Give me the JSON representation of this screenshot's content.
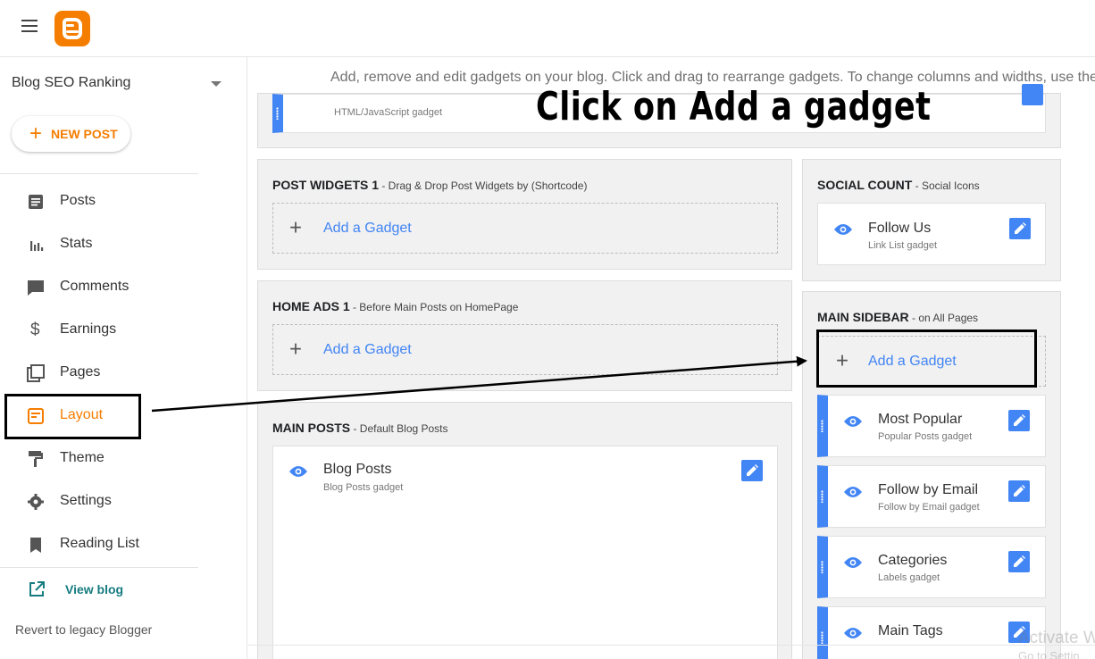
{
  "header": {
    "menu_icon": "hamburger-menu-icon",
    "logo_icon": "blogger-logo-icon",
    "brand_color": "#f57d00"
  },
  "sidebar": {
    "blog_name": "Blog SEO Ranking",
    "new_post_label": "NEW POST",
    "items": [
      {
        "label": "Posts",
        "icon": "posts-icon"
      },
      {
        "label": "Stats",
        "icon": "stats-icon"
      },
      {
        "label": "Comments",
        "icon": "comments-icon"
      },
      {
        "label": "Earnings",
        "icon": "earnings-icon"
      },
      {
        "label": "Pages",
        "icon": "pages-icon"
      },
      {
        "label": "Layout",
        "icon": "layout-icon",
        "active": true
      },
      {
        "label": "Theme",
        "icon": "theme-icon"
      },
      {
        "label": "Settings",
        "icon": "settings-icon"
      },
      {
        "label": "Reading List",
        "icon": "bookmark-icon"
      }
    ],
    "view_blog_label": "View blog",
    "revert_label": "Revert to legacy Blogger"
  },
  "main": {
    "instructions": "Add, remove and edit gadgets on your blog. Click and drag to rearrange gadgets. To change columns and widths, use the T",
    "annotation": "Click on Add a gadget",
    "top_gadget": {
      "subtitle": "HTML/JavaScript gadget"
    },
    "sections": {
      "post_widgets": {
        "title": "POST WIDGETS 1",
        "subtitle": " - Drag & Drop Post Widgets by (Shortcode)",
        "add_label": "Add a Gadget"
      },
      "home_ads": {
        "title": "HOME ADS 1",
        "subtitle": " - Before Main Posts on HomePage",
        "add_label": "Add a Gadget"
      },
      "main_posts": {
        "title": "MAIN POSTS",
        "subtitle": " - Default Blog Posts",
        "gadget_title": "Blog Posts",
        "gadget_subtitle": "Blog Posts gadget"
      },
      "social_count": {
        "title": "SOCIAL COUNT",
        "subtitle": " - Social Icons",
        "gadget_title": "Follow Us",
        "gadget_subtitle": "Link List gadget"
      },
      "main_sidebar": {
        "title": "MAIN SIDEBAR",
        "subtitle": " - on All Pages",
        "add_label": "Add a Gadget",
        "gadgets": [
          {
            "title": "Most Popular",
            "subtitle": "Popular Posts gadget"
          },
          {
            "title": "Follow by Email",
            "subtitle": "Follow by Email gadget"
          },
          {
            "title": "Categories",
            "subtitle": "Labels gadget"
          },
          {
            "title": "Main Tags",
            "subtitle": ""
          }
        ]
      }
    }
  },
  "watermark": {
    "line1": "Activate W",
    "line2": "Go to Settin"
  },
  "colors": {
    "accent_blue": "#4285f4",
    "link_teal": "#167c80"
  }
}
